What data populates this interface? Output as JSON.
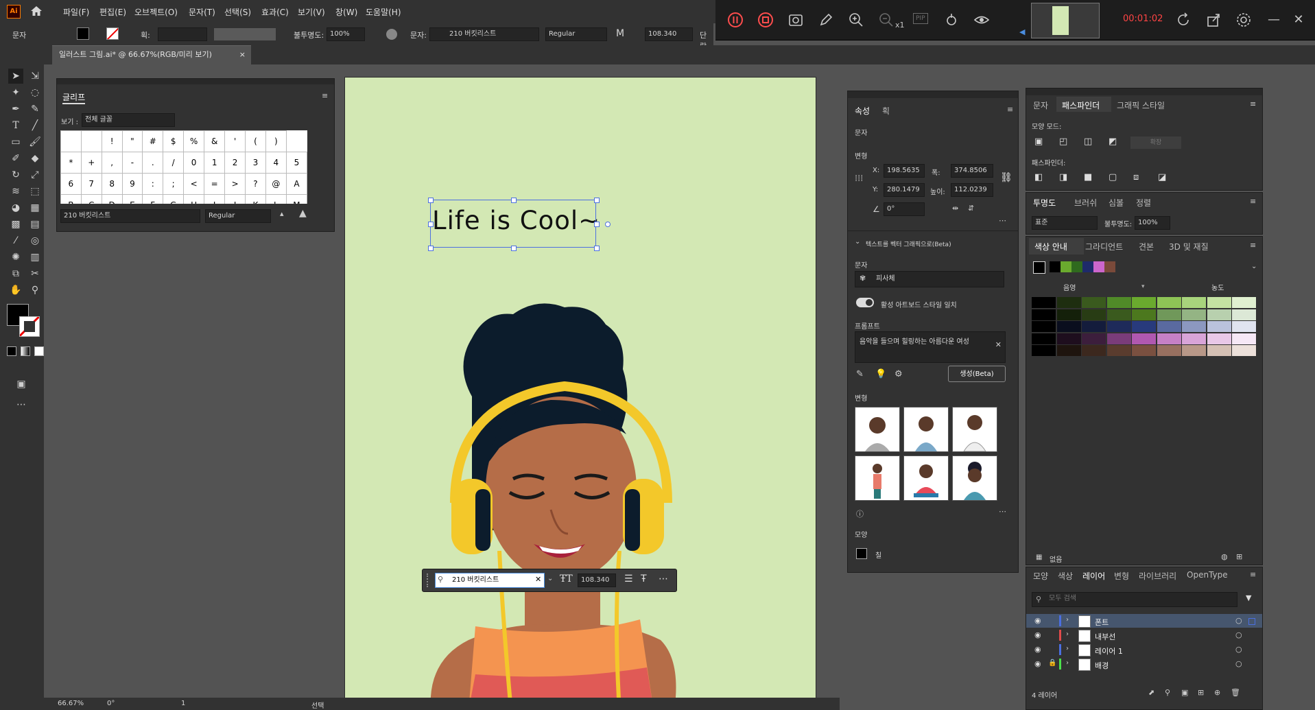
{
  "app": {
    "logo": "Ai",
    "home_icon": "home-icon"
  },
  "menu": [
    "파일(F)",
    "편집(E)",
    "오브젝트(O)",
    "문자(T)",
    "선택(S)",
    "효과(C)",
    "보기(V)",
    "창(W)",
    "도움말(H)"
  ],
  "recorder": {
    "timer": "00:01:02",
    "zoom_label": "x1",
    "pip_label": "PIP",
    "timer_color": "#ff4444"
  },
  "control_bar": {
    "mode": "문자",
    "stroke_label": "획:",
    "opacity_label": "불투명도:",
    "opacity_value": "100%",
    "char_label": "문자:",
    "font_name": "210 버킷리스트",
    "font_style": "Regular",
    "font_size": "108.340",
    "align_label": "단락"
  },
  "doc_tab": {
    "title": "일러스트 그림.ai* @ 66.67%(RGB/미리 보기)",
    "close": "×"
  },
  "glyph_panel": {
    "title": "글리프",
    "view_label": "보기 :",
    "view_value": "전체 글꼴",
    "rows": [
      [
        "",
        "",
        "!",
        "\"",
        "#",
        "$",
        "%",
        "&",
        "'",
        "(",
        ")"
      ],
      [
        "*",
        "+",
        ",",
        "-",
        ".",
        "/",
        "0",
        "1",
        "2",
        "3",
        "4",
        "5"
      ],
      [
        "6",
        "7",
        "8",
        "9",
        ":",
        ";",
        "<",
        "=",
        ">",
        "?",
        "@",
        "A"
      ],
      [
        "B",
        "C",
        "D",
        "E",
        "F",
        "G",
        "H",
        "I",
        "J",
        "K",
        "L",
        "M"
      ]
    ],
    "font": "210 버킷리스트",
    "style": "Regular"
  },
  "artboard": {
    "headline": "Life is Cool~",
    "bg_color": "#d3e8b4"
  },
  "context_bar": {
    "font": "210 버킷리스트",
    "size": "108.340"
  },
  "properties_panel": {
    "tabs": [
      "속성",
      "획"
    ],
    "section_type": "문자",
    "transform_label": "변형",
    "x_label": "X:",
    "x": "198.5635",
    "y_label": "Y:",
    "y": "280.1479",
    "w_label": "폭:",
    "w": "374.8506",
    "h_label": "높이:",
    "h": "112.0239",
    "angle": "0°",
    "vector_title": "텍스트를 벡터 그래픽으로(Beta)",
    "subject_label": "문자",
    "subject_value": "피사체",
    "toggle_label": "활성 아트보드 스타일 일치",
    "prompt_label": "프롬프트",
    "prompt_text": "음악을 들으며 힐링하는 아름다운 여성",
    "generate_button": "생성(Beta)",
    "variations_label": "변형",
    "appearance_label": "모양",
    "fill_label": "칠"
  },
  "pathfinder_panel": {
    "tabs": [
      "문자",
      "패스파인더",
      "그래픽 스타일"
    ],
    "shape_modes_label": "모양 모드:",
    "expand_button": "확장",
    "pathfinders_label": "패스파인더:"
  },
  "transparency_panel": {
    "tabs": [
      "투명도",
      "브러쉬",
      "심볼",
      "정렬"
    ],
    "blend_mode": "표준",
    "opacity_label": "불투명도:",
    "opacity": "100%"
  },
  "color_guide_panel": {
    "tabs": [
      "색상 안내",
      "그라디언트",
      "견본",
      "3D 및 재질"
    ],
    "shade_label": "음영",
    "tint_label": "농도",
    "harmony": [
      "#000000",
      "#6aaa2e",
      "#2f6a1e",
      "#1e2a6a",
      "#cc66cc",
      "#7a4a3a"
    ],
    "grid": [
      [
        "#000000",
        "#1e2e10",
        "#3a5a1e",
        "#508a28",
        "#6aaa2e",
        "#8ec456",
        "#a8d47c",
        "#c4e2a2",
        "#e0f0d0"
      ],
      [
        "#000000",
        "#14200a",
        "#283c14",
        "#3a5a1e",
        "#4c781e",
        "#70985a",
        "#94b484",
        "#b8d0ae",
        "#dce8d6"
      ],
      [
        "#000000",
        "#0a0e1e",
        "#141c3c",
        "#1e2a5a",
        "#283a7c",
        "#5a6aa0",
        "#8c98c0",
        "#bac2dc",
        "#e0e4f0"
      ],
      [
        "#000000",
        "#1e0e1e",
        "#3c1e3c",
        "#7a3c7a",
        "#b058b0",
        "#c680c6",
        "#d8a4d8",
        "#e8c8e8",
        "#f6e8f6"
      ],
      [
        "#000000",
        "#1e140e",
        "#3c281e",
        "#5a3c2e",
        "#7a5040",
        "#987060",
        "#b89888",
        "#d4c0b4",
        "#ece0da"
      ]
    ],
    "none_label": "없음"
  },
  "layers_panel": {
    "tabs": [
      "모양",
      "색상",
      "레이어",
      "변형",
      "라이브러리",
      "OpenType"
    ],
    "search_placeholder": "모두 검색",
    "layers": [
      {
        "name": "폰트",
        "color": "#4b6fe0",
        "selected": true,
        "locked": false
      },
      {
        "name": "내부선",
        "color": "#e04b4b",
        "selected": false,
        "locked": false
      },
      {
        "name": "레이어 1",
        "color": "#4b6fe0",
        "selected": false,
        "locked": false
      },
      {
        "name": "배경",
        "color": "#4be04b",
        "selected": false,
        "locked": true
      }
    ],
    "count": "4 레이어"
  },
  "status": {
    "zoom": "66.67%",
    "rotate": "0°",
    "artboard_num": "1",
    "tool": "선택"
  }
}
